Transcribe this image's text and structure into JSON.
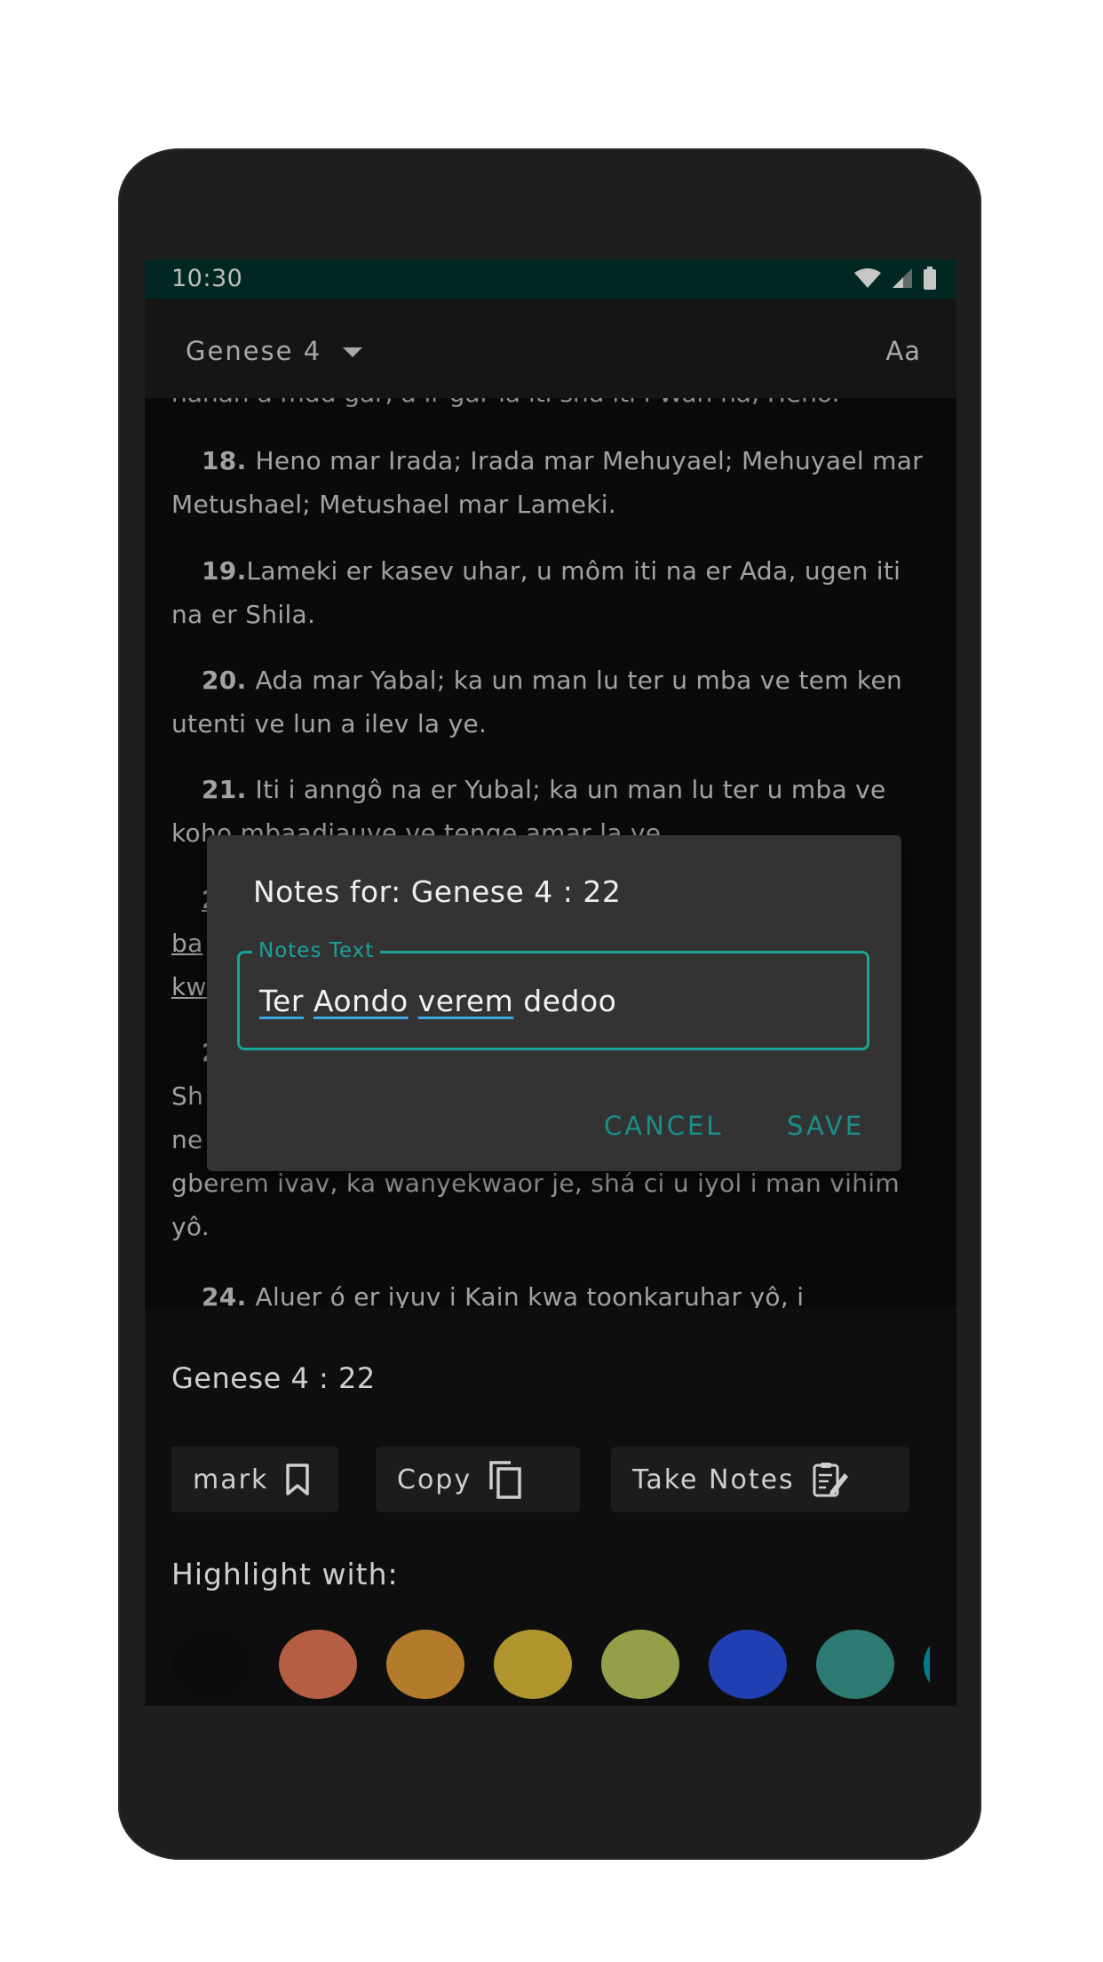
{
  "status_bar": {
    "time": "10:30"
  },
  "app_bar": {
    "book_selector": "Genese 4",
    "font_button": "Aa"
  },
  "verses": [
    {
      "text": "nahan a mdd gar, a ir gar la iti shd iti i Wan na, Heno."
    },
    {
      "num": "18.",
      "text": "Heno mar Irada; Irada mar Mehuyael; Mehuyael mar Metushael; Metushael mar Lameki."
    },
    {
      "num": "19.",
      "text": "Lameki er kasev uhar, u môm iti na er Ada, ugen iti na er Shila."
    },
    {
      "num": "20.",
      "text": "Ada mar Yabal; ka un man lu ter u mba ve tem ken utenti ve lun a ilev la ye."
    },
    {
      "num": "21.",
      "text": "Iti i anngô na er Yubal; ka un man lu ter u mba ve koho mbaadiauve ve tenge amar la ye."
    },
    {
      "num": "2",
      "text": "ba"
    },
    {
      "text": "kw"
    },
    {
      "num": "2",
      "text": ""
    },
    {
      "text": "Sh"
    },
    {
      "text": "ne"
    },
    {
      "text": "gberem ivav, ka wanyekwaor je, shá ci u iyol i man vihim"
    },
    {
      "text": "yô."
    },
    {
      "num": "24.",
      "text": "Aluer ó er iyuv i Kain kwa toonkaruhar yô, i"
    }
  ],
  "bottom_panel": {
    "reference": "Genese 4 : 22",
    "actions": [
      {
        "label": "mark",
        "icon": "bookmark-icon"
      },
      {
        "label": "Copy",
        "icon": "copy-icon"
      },
      {
        "label": "Take Notes",
        "icon": "notes-icon"
      }
    ],
    "highlight_label": "Highlight with:",
    "highlight_colors": [
      "#0c0c0c",
      "#b45e43",
      "#b27c2c",
      "#b0952f",
      "#959f4a",
      "#1f3fb3",
      "#2d7a72",
      "#007e8e"
    ]
  },
  "dialog": {
    "title": "Notes for: Genese 4 : 22",
    "field_label": "Notes Text",
    "words": [
      "Ter",
      "Aondo",
      "verem",
      "dedoo"
    ],
    "cancel": "CANCEL",
    "save": "SAVE"
  }
}
